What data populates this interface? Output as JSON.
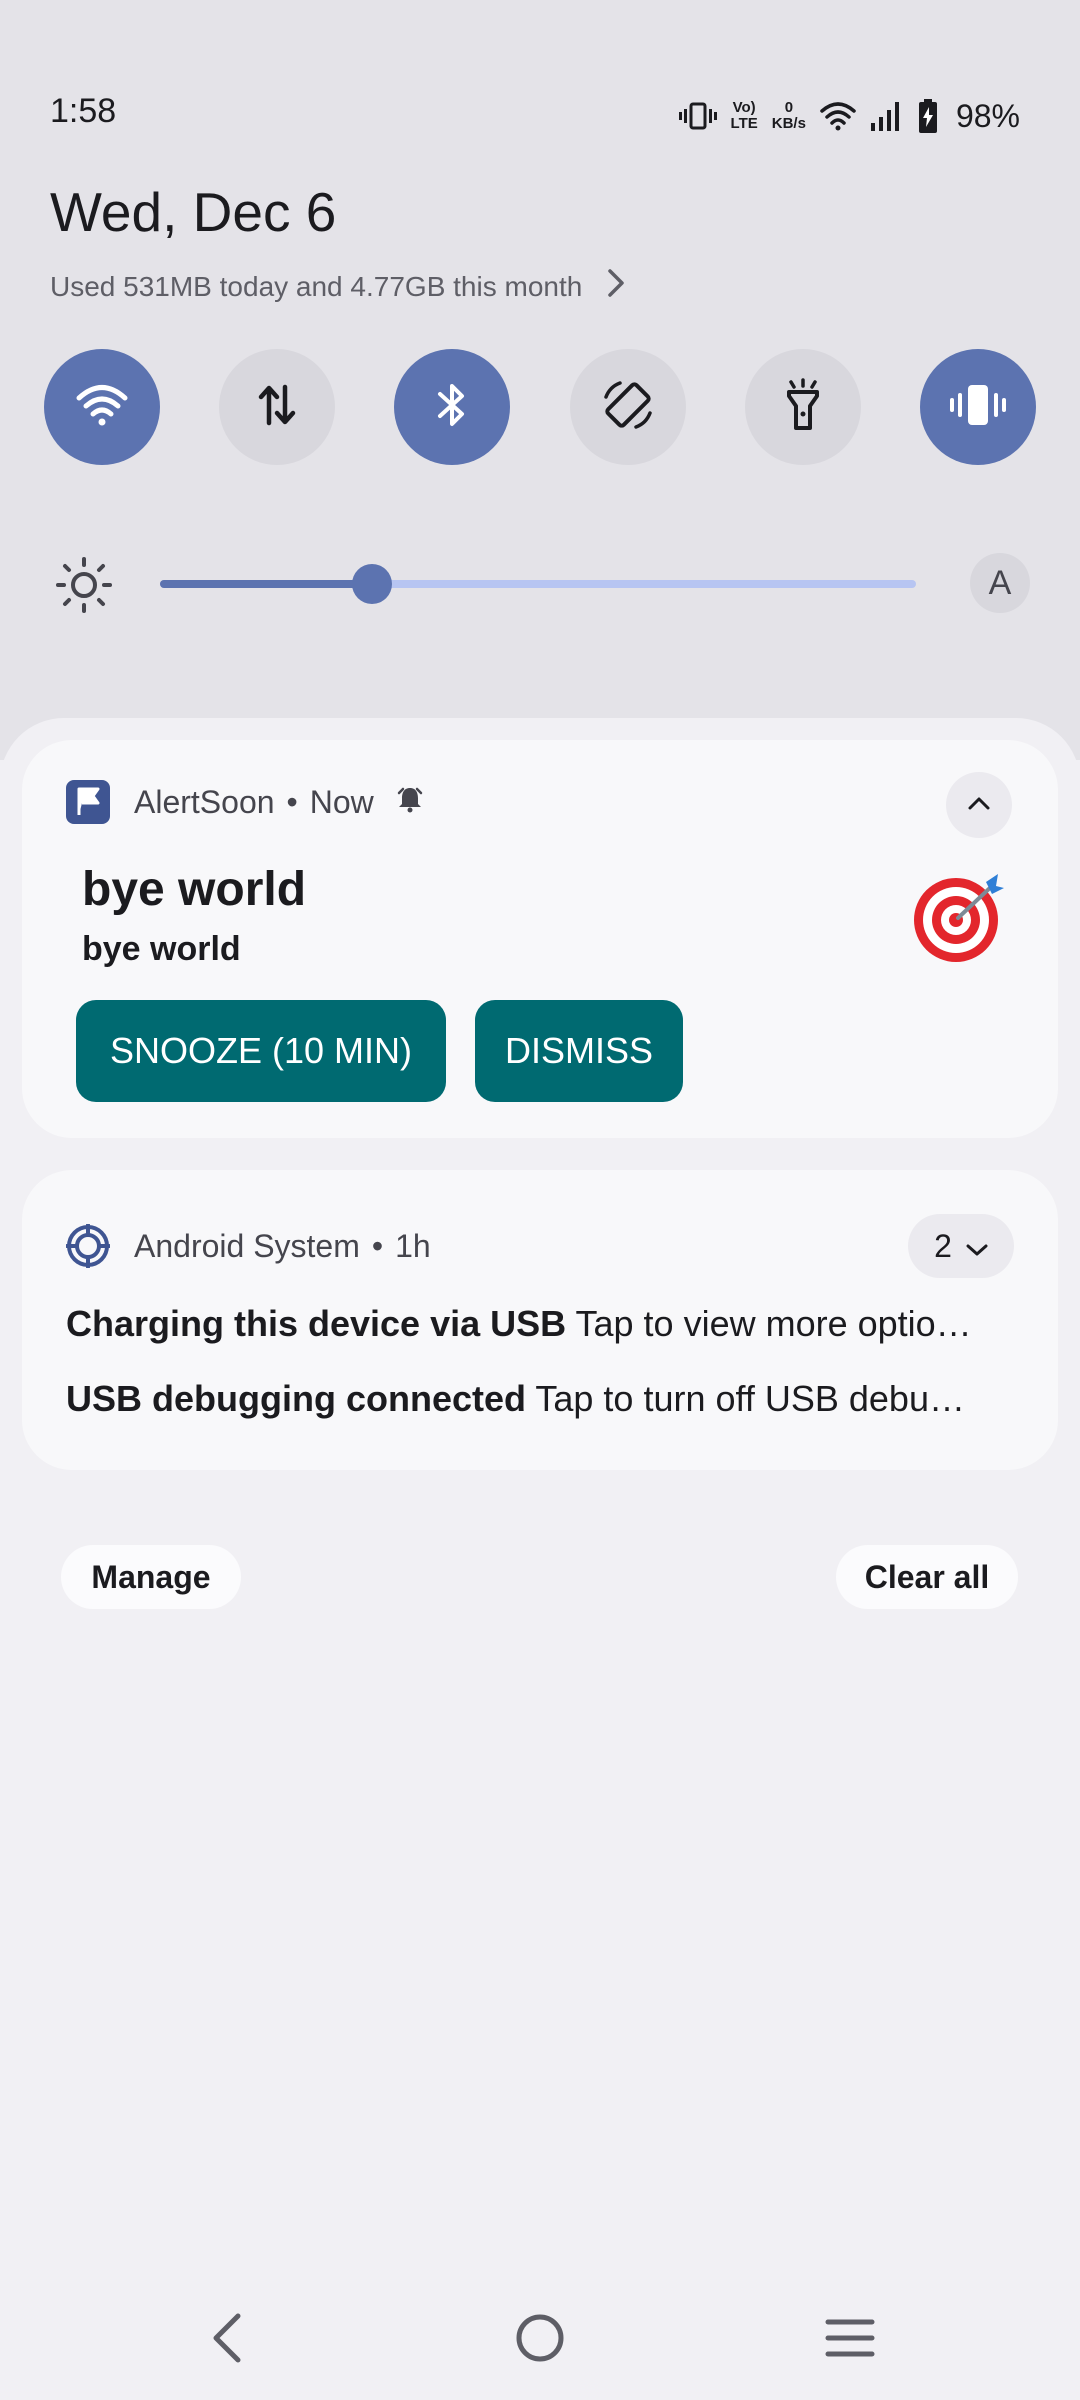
{
  "status_bar": {
    "time": "1:58",
    "network_speed_value": "0",
    "network_speed_unit": "KB/s",
    "volte_top": "Vo)",
    "volte_bottom": "LTE",
    "battery": "98%",
    "icons": [
      "vibrate-icon",
      "volte-icon",
      "network-speed",
      "wifi-icon",
      "signal-icon",
      "battery-charging-icon"
    ]
  },
  "header": {
    "date": "Wed, Dec 6",
    "data_usage": "Used 531MB today and 4.77GB this month"
  },
  "quick_settings": {
    "tiles": [
      {
        "icon": "wifi-icon",
        "active": true
      },
      {
        "icon": "mobile-data-icon",
        "active": false
      },
      {
        "icon": "bluetooth-icon",
        "active": true
      },
      {
        "icon": "auto-rotate-icon",
        "active": false
      },
      {
        "icon": "flashlight-icon",
        "active": false
      },
      {
        "icon": "vibrate-icon",
        "active": true
      }
    ],
    "brightness": {
      "level": 0.28,
      "auto_label": "A"
    }
  },
  "colors": {
    "accent": "#5c73b0",
    "action_button": "#006a71",
    "slider_track": "#b7c5f2"
  },
  "notifications": [
    {
      "app": "AlertSoon",
      "time": "Now",
      "title": "bye world",
      "text": "bye world",
      "actions": [
        "SNOOZE (10 MIN)",
        "DISMISS"
      ]
    },
    {
      "app": "Android System",
      "time": "1h",
      "count": "2",
      "lines": [
        {
          "title": "Charging this device via USB",
          "text": "Tap to view more optio…"
        },
        {
          "title": "USB debugging connected",
          "text": "Tap to turn off USB debu…"
        }
      ]
    }
  ],
  "footer": {
    "manage": "Manage",
    "clear_all": "Clear all"
  },
  "nav": [
    "back",
    "home",
    "recents"
  ]
}
